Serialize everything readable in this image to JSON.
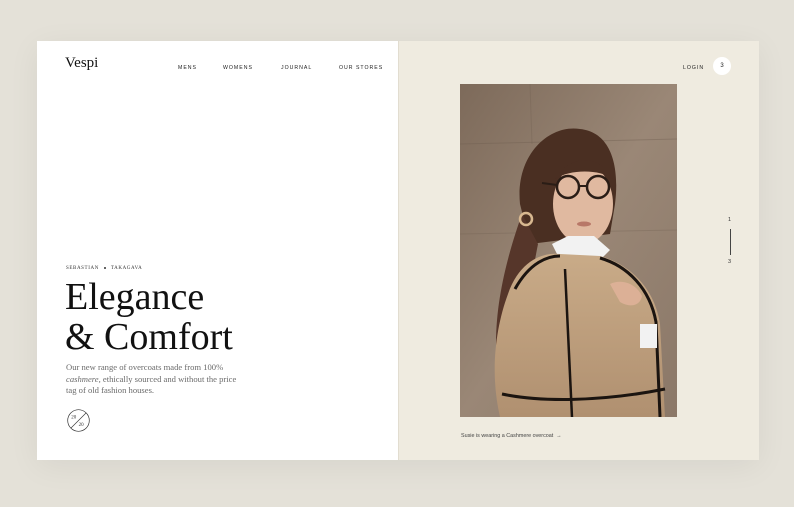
{
  "brand": {
    "logo": "Vespi"
  },
  "nav": {
    "items": [
      "MENS",
      "WOMENS",
      "JOURNAL",
      "OUR STORES"
    ]
  },
  "header": {
    "login_label": "LOGIN",
    "cart_count": "3"
  },
  "hero": {
    "authors": [
      "SEBASTIAN",
      "TAKAGAVA"
    ],
    "headline_line1": "Elegance",
    "headline_line2": "& Comfort",
    "description_part1": "Our new range of overcoats made from 100%",
    "description_italic": "cashmere,",
    "description_part2": " ethically sourced and without the price tag of old fashion houses.",
    "badge_top": "20",
    "badge_bottom": "20"
  },
  "photo": {
    "caption": "Susie is wearing a Cashmere overcoat",
    "caption_arrow": "→"
  },
  "pager": {
    "current": "1",
    "total": "3"
  },
  "colors": {
    "page_bg": "#e4e1d8",
    "panel_right": "#efebe0",
    "text_dark": "#111111",
    "text_muted": "#6b6b6b"
  }
}
